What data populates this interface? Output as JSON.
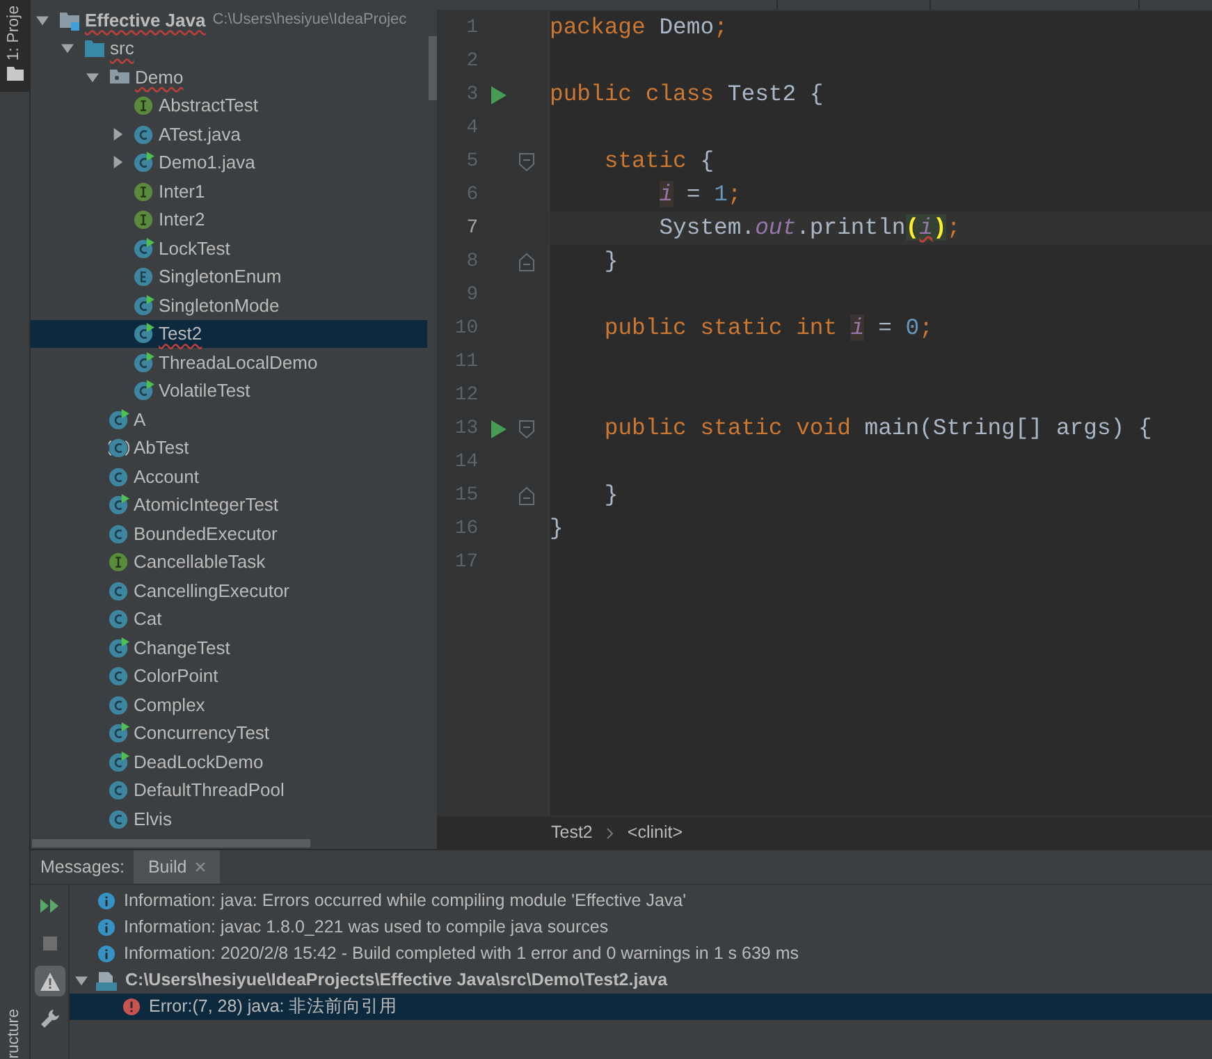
{
  "side_stripe": {
    "top_tab": "1: Proje",
    "bottom_tab": "ructure"
  },
  "project_tree": [
    {
      "label": "Effective Java",
      "path": "C:\\Users\\hesiyue\\IdeaProjec",
      "kind": "module",
      "expanded": true,
      "error": true,
      "selected": false,
      "children": [
        {
          "label": "src",
          "kind": "source-folder",
          "expanded": true,
          "error": true,
          "selected": false,
          "children": [
            {
              "label": "Demo",
              "kind": "package",
              "expanded": true,
              "error": true,
              "selected": false,
              "children": [
                {
                  "label": "AbstractTest",
                  "kind": "interface",
                  "error": false,
                  "selected": false
                },
                {
                  "label": "ATest.java",
                  "kind": "class",
                  "expanded": false,
                  "error": false,
                  "selected": false
                },
                {
                  "label": "Demo1.java",
                  "kind": "class-runnable",
                  "expanded": false,
                  "error": false,
                  "selected": false
                },
                {
                  "label": "Inter1",
                  "kind": "interface",
                  "error": false,
                  "selected": false
                },
                {
                  "label": "Inter2",
                  "kind": "interface",
                  "error": false,
                  "selected": false
                },
                {
                  "label": "LockTest",
                  "kind": "class-runnable",
                  "error": false,
                  "selected": false
                },
                {
                  "label": "SingletonEnum",
                  "kind": "enum",
                  "error": false,
                  "selected": false
                },
                {
                  "label": "SingletonMode",
                  "kind": "class-runnable",
                  "error": false,
                  "selected": false
                },
                {
                  "label": "Test2",
                  "kind": "class-runnable",
                  "error": true,
                  "selected": true
                },
                {
                  "label": "ThreadaLocalDemo",
                  "kind": "class-runnable",
                  "error": false,
                  "selected": false
                },
                {
                  "label": "VolatileTest",
                  "kind": "class-runnable",
                  "error": false,
                  "selected": false
                }
              ]
            },
            {
              "label": "A",
              "kind": "class-runnable",
              "error": false,
              "selected": false
            },
            {
              "label": "AbTest",
              "kind": "abstract",
              "error": false,
              "selected": false
            },
            {
              "label": "Account",
              "kind": "class",
              "error": false,
              "selected": false
            },
            {
              "label": "AtomicIntegerTest",
              "kind": "class-runnable",
              "error": false,
              "selected": false
            },
            {
              "label": "BoundedExecutor",
              "kind": "class",
              "error": false,
              "selected": false
            },
            {
              "label": "CancellableTask",
              "kind": "interface",
              "error": false,
              "selected": false
            },
            {
              "label": "CancellingExecutor",
              "kind": "class",
              "error": false,
              "selected": false
            },
            {
              "label": "Cat",
              "kind": "class",
              "error": false,
              "selected": false
            },
            {
              "label": "ChangeTest",
              "kind": "class-runnable",
              "error": false,
              "selected": false
            },
            {
              "label": "ColorPoint",
              "kind": "class",
              "error": false,
              "selected": false
            },
            {
              "label": "Complex",
              "kind": "class",
              "error": false,
              "selected": false
            },
            {
              "label": "ConcurrencyTest",
              "kind": "class-runnable",
              "error": false,
              "selected": false
            },
            {
              "label": "DeadLockDemo",
              "kind": "class-runnable",
              "error": false,
              "selected": false
            },
            {
              "label": "DefaultThreadPool",
              "kind": "class",
              "error": false,
              "selected": false
            },
            {
              "label": "Elvis",
              "kind": "class",
              "error": false,
              "selected": false
            }
          ]
        }
      ]
    }
  ],
  "editor": {
    "lines": [
      {
        "number": "1",
        "run": false,
        "current": false,
        "fold_start": false,
        "fold_end": false,
        "tokens": [
          {
            "text": "package",
            "kind": "keyword"
          },
          {
            "text": " Demo",
            "kind": "plain"
          },
          {
            "text": ";",
            "kind": "keyword"
          }
        ]
      },
      {
        "number": "2",
        "run": false,
        "current": false,
        "fold_start": false,
        "fold_end": false
      },
      {
        "number": "3",
        "run": true,
        "current": false,
        "fold_start": false,
        "fold_end": false,
        "tokens": [
          {
            "text": "public class",
            "kind": "keyword"
          },
          {
            "text": " Test2 {",
            "kind": "plain"
          }
        ]
      },
      {
        "number": "4",
        "run": false,
        "current": false,
        "fold_start": false,
        "fold_end": false
      },
      {
        "number": "5",
        "run": false,
        "current": false,
        "fold_start": true,
        "fold_end": false,
        "tokens": [
          {
            "text": "    static",
            "kind": "keyword"
          },
          {
            "text": " {",
            "kind": "plain"
          }
        ]
      },
      {
        "number": "6",
        "run": false,
        "current": false,
        "fold_start": false,
        "fold_end": false,
        "tokens": [
          {
            "text": "        i",
            "kind": "field-marked"
          },
          {
            "text": " = ",
            "kind": "plain"
          },
          {
            "text": "1",
            "kind": "number"
          },
          {
            "text": ";",
            "kind": "keyword"
          }
        ]
      },
      {
        "number": "7",
        "run": false,
        "current": true,
        "fold_start": false,
        "fold_end": false,
        "tokens": [
          {
            "text": "        System.",
            "kind": "plain"
          },
          {
            "text": "out",
            "kind": "field"
          },
          {
            "text": ".println",
            "kind": "plain"
          },
          {
            "text": "(",
            "kind": "brace-match"
          },
          {
            "text": "i",
            "kind": "field-error"
          },
          {
            "text": ")",
            "kind": "brace-match"
          },
          {
            "text": ";",
            "kind": "keyword"
          }
        ]
      },
      {
        "number": "8",
        "run": false,
        "current": false,
        "fold_start": false,
        "fold_end": true,
        "tokens": [
          {
            "text": "    }",
            "kind": "plain"
          }
        ]
      },
      {
        "number": "9",
        "run": false,
        "current": false,
        "fold_start": false,
        "fold_end": false
      },
      {
        "number": "10",
        "run": false,
        "current": false,
        "fold_start": false,
        "fold_end": false,
        "tokens": [
          {
            "text": "    public static int ",
            "kind": "keyword"
          },
          {
            "text": "i",
            "kind": "field-marked"
          },
          {
            "text": " = ",
            "kind": "plain"
          },
          {
            "text": "0",
            "kind": "number"
          },
          {
            "text": ";",
            "kind": "keyword"
          }
        ]
      },
      {
        "number": "11",
        "run": false,
        "current": false,
        "fold_start": false,
        "fold_end": false
      },
      {
        "number": "12",
        "run": false,
        "current": false,
        "fold_start": false,
        "fold_end": false
      },
      {
        "number": "13",
        "run": true,
        "current": false,
        "fold_start": true,
        "fold_end": false,
        "tokens": [
          {
            "text": "    public static void ",
            "kind": "keyword"
          },
          {
            "text": "main(String[] args) {",
            "kind": "plain"
          }
        ]
      },
      {
        "number": "14",
        "run": false,
        "current": false,
        "fold_start": false,
        "fold_end": false
      },
      {
        "number": "15",
        "run": false,
        "current": false,
        "fold_start": false,
        "fold_end": true,
        "tokens": [
          {
            "text": "    }",
            "kind": "plain"
          }
        ]
      },
      {
        "number": "16",
        "run": false,
        "current": false,
        "fold_start": false,
        "fold_end": false,
        "tokens": [
          {
            "text": "}",
            "kind": "plain"
          }
        ]
      },
      {
        "number": "17",
        "run": false,
        "current": false,
        "fold_start": false,
        "fold_end": false
      }
    ],
    "breadcrumbs": [
      "Test2",
      "<clinit>"
    ]
  },
  "messages_panel": {
    "label": "Messages:",
    "tabs": [
      {
        "label": "Build",
        "selected": true
      }
    ],
    "messages": [
      {
        "kind": "info",
        "text": "Information: java: Errors occurred while compiling module 'Effective Java'",
        "selected": false
      },
      {
        "kind": "info",
        "text": "Information: javac 1.8.0_221 was used to compile java sources",
        "selected": false
      },
      {
        "kind": "info",
        "text": "Information: 2020/2/8 15:42 - Build completed with 1 error and 0 warnings in 1 s 639 ms",
        "selected": false
      },
      {
        "kind": "file",
        "text": "C:\\Users\\hesiyue\\IdeaProjects\\Effective Java\\src\\Demo\\Test2.java",
        "expanded": true,
        "selected": false,
        "children": [
          {
            "kind": "error",
            "text": "Error:(7, 28)  java: 非法前向引用",
            "selected": true
          }
        ]
      }
    ]
  }
}
